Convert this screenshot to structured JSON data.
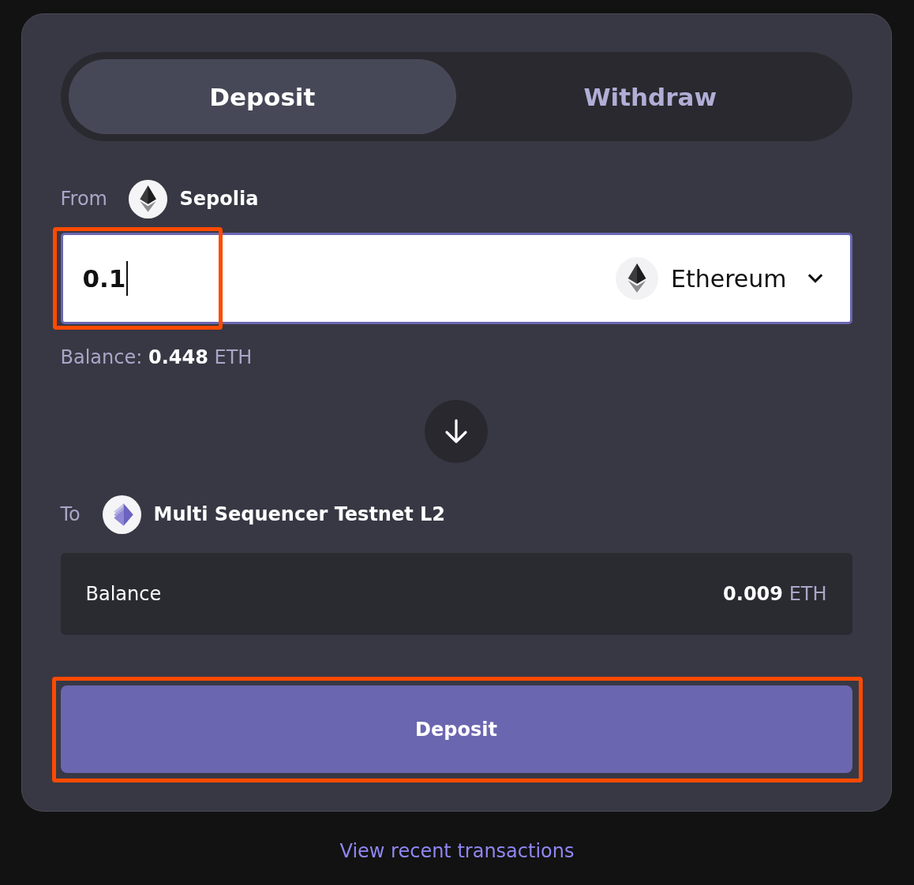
{
  "tabs": [
    {
      "label": "Deposit",
      "selected": true
    },
    {
      "label": "Withdraw",
      "selected": false
    }
  ],
  "from": {
    "label": "From",
    "network": "Sepolia"
  },
  "amount": {
    "value": "0.1",
    "highlighted": true
  },
  "token": {
    "name": "Ethereum"
  },
  "source_balance": {
    "label": "Balance:",
    "amount": "0.448",
    "unit": "ETH"
  },
  "to": {
    "label": "To",
    "network": "Multi Sequencer Testnet L2"
  },
  "destination_balance": {
    "label": "Balance",
    "amount": "0.009",
    "unit": "ETH"
  },
  "submit": {
    "label": "Deposit",
    "highlighted": true
  },
  "footer_link": "View recent transactions"
}
